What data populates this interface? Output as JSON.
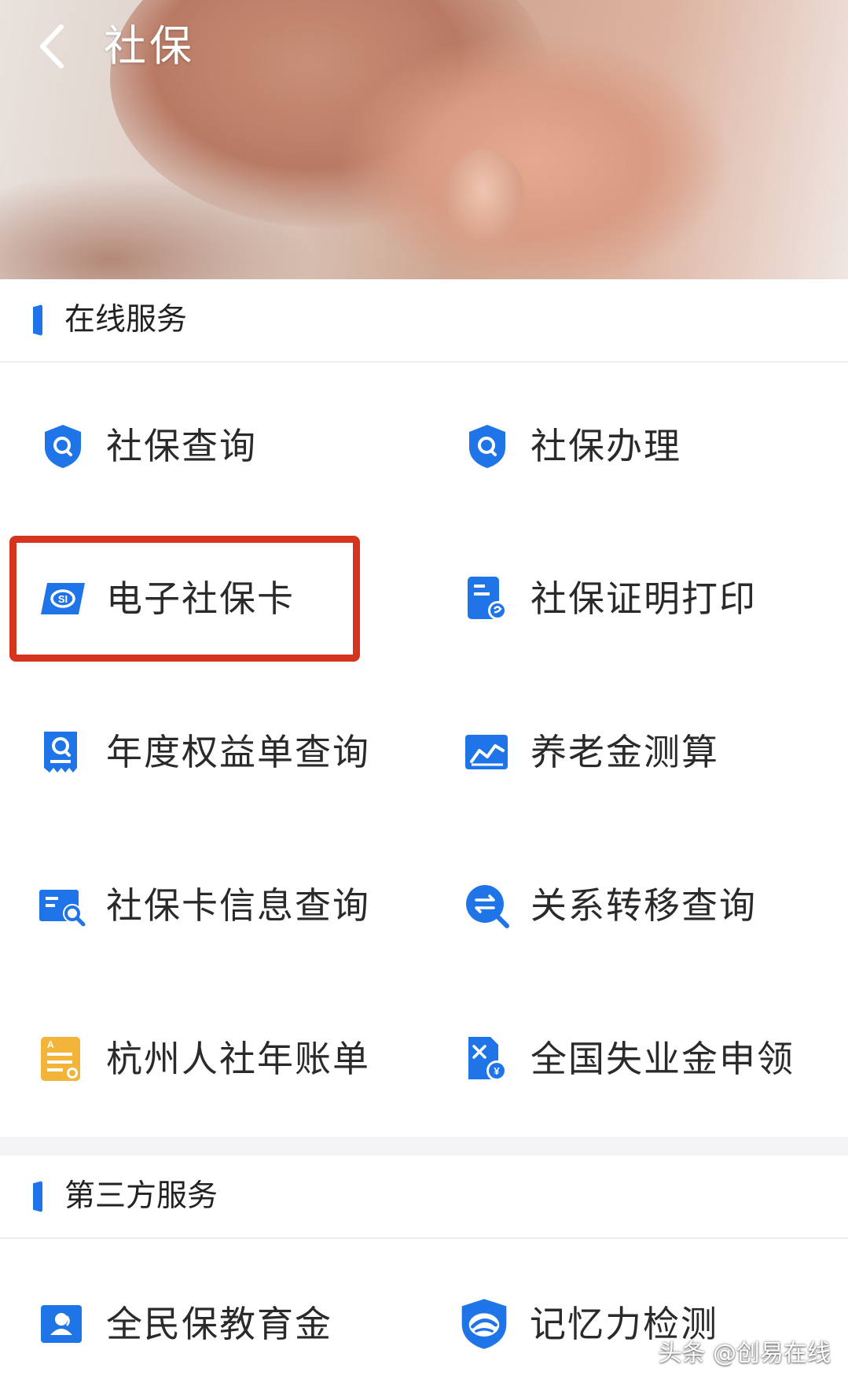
{
  "header": {
    "title": "社保",
    "back_icon": "chevron-left-icon"
  },
  "colors": {
    "accent": "#1f75e8",
    "highlight": "#d5341f",
    "text": "#2a2a2a",
    "bill_icon": "#f3b43a"
  },
  "online_services": {
    "title": "在线服务",
    "items": [
      {
        "label": "社保查询",
        "icon": "shield-search-icon"
      },
      {
        "label": "社保办理",
        "icon": "shield-search-icon"
      },
      {
        "label": "电子社保卡",
        "icon": "social-security-card-icon"
      },
      {
        "label": "社保证明打印",
        "icon": "certificate-print-icon"
      },
      {
        "label": "年度权益单查询",
        "icon": "receipt-search-icon"
      },
      {
        "label": "养老金测算",
        "icon": "line-chart-icon"
      },
      {
        "label": "社保卡信息查询",
        "icon": "card-search-icon"
      },
      {
        "label": "关系转移查询",
        "icon": "transfer-search-icon"
      },
      {
        "label": "杭州人社年账单",
        "icon": "annual-bill-icon"
      },
      {
        "label": "全国失业金申领",
        "icon": "unemployment-benefit-icon"
      }
    ]
  },
  "third_party_services": {
    "title": "第三方服务",
    "items": [
      {
        "label": "全民保教育金",
        "icon": "user-card-icon"
      },
      {
        "label": "记忆力检测",
        "icon": "shield-brain-icon"
      }
    ]
  },
  "watermark": "头条 @创易在线"
}
